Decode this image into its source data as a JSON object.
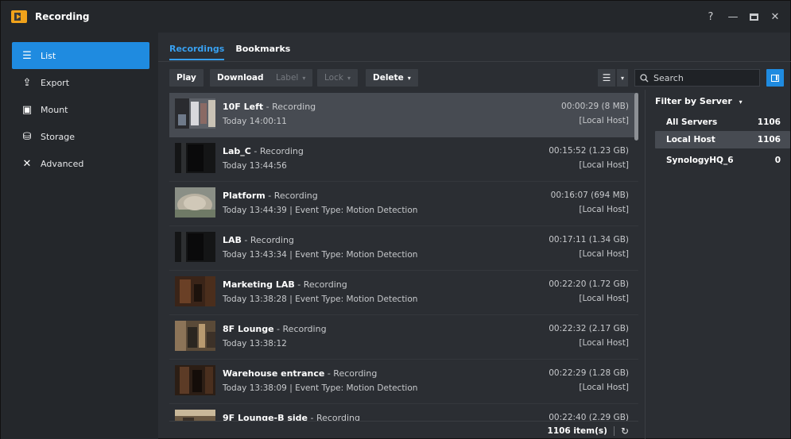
{
  "app": {
    "title": "Recording"
  },
  "window_controls": {
    "help": "?",
    "minimize": "—",
    "close": "✕"
  },
  "sidebar": {
    "items": [
      {
        "label": "List",
        "icon": "list-icon",
        "glyph": "☰",
        "active": true
      },
      {
        "label": "Export",
        "icon": "export-icon",
        "glyph": "⇪",
        "active": false
      },
      {
        "label": "Mount",
        "icon": "mount-icon",
        "glyph": "▣",
        "active": false
      },
      {
        "label": "Storage",
        "icon": "storage-icon",
        "glyph": "⛁",
        "active": false
      },
      {
        "label": "Advanced",
        "icon": "advanced-tools-icon",
        "glyph": "✕",
        "active": false
      }
    ]
  },
  "tabs": [
    {
      "label": "Recordings",
      "active": true
    },
    {
      "label": "Bookmarks",
      "active": false
    }
  ],
  "toolbar": {
    "play": "Play",
    "download": "Download",
    "label": "Label",
    "lock": "Lock",
    "delete": "Delete"
  },
  "search": {
    "placeholder": "Search"
  },
  "recordings": [
    {
      "name": "10F Left",
      "status": "Recording",
      "sub": "Today 14:00:11",
      "duration": "00:00:29 (8 MB)",
      "host": "[Local Host]",
      "selected": true
    },
    {
      "name": "Lab_C",
      "status": "Recording",
      "sub": "Today 13:44:56",
      "duration": "00:15:52 (1.23 GB)",
      "host": "[Local Host]",
      "selected": false
    },
    {
      "name": "Platform",
      "status": "Recording",
      "sub": "Today 13:44:39 | Event Type: Motion Detection",
      "duration": "00:16:07 (694 MB)",
      "host": "[Local Host]",
      "selected": false
    },
    {
      "name": "LAB",
      "status": "Recording",
      "sub": "Today 13:43:34 | Event Type: Motion Detection",
      "duration": "00:17:11 (1.34 GB)",
      "host": "[Local Host]",
      "selected": false
    },
    {
      "name": "Marketing LAB",
      "status": "Recording",
      "sub": "Today 13:38:28 | Event Type: Motion Detection",
      "duration": "00:22:20 (1.72 GB)",
      "host": "[Local Host]",
      "selected": false
    },
    {
      "name": "8F Lounge",
      "status": "Recording",
      "sub": "Today 13:38:12",
      "duration": "00:22:32 (2.17 GB)",
      "host": "[Local Host]",
      "selected": false
    },
    {
      "name": "Warehouse entrance",
      "status": "Recording",
      "sub": "Today 13:38:09 | Event Type: Motion Detection",
      "duration": "00:22:29 (1.28 GB)",
      "host": "[Local Host]",
      "selected": false
    },
    {
      "name": "9F Lounge-B side",
      "status": "Recording",
      "sub": "",
      "duration": "00:22:40 (2.29 GB)",
      "host": "",
      "selected": false
    }
  ],
  "footer": {
    "count": "1106 item(s)",
    "refresh_glyph": "↻"
  },
  "filter": {
    "title": "Filter by Server",
    "servers": [
      {
        "name": "All Servers",
        "count": "1106",
        "selected": false
      },
      {
        "name": "Local Host",
        "count": "1106",
        "selected": true
      },
      {
        "name": "SynologyHQ_6",
        "count": "0",
        "selected": false
      }
    ]
  },
  "colors": {
    "accent": "#1f8be0",
    "tab_active": "#38a0f0",
    "background": "#2b2e33"
  }
}
